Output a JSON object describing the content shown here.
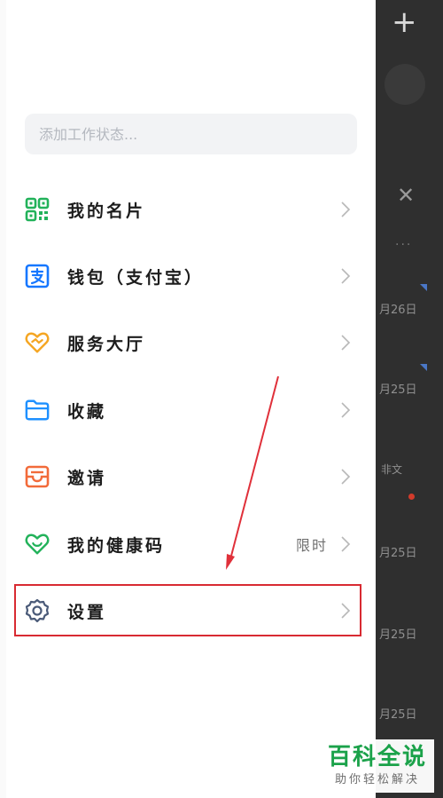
{
  "background": {
    "dates": [
      "月26日",
      "月25日",
      "月25日",
      "月25日",
      "月25日"
    ],
    "note": "非文"
  },
  "status": {
    "placeholder": "添加工作状态..."
  },
  "menu": [
    {
      "label": "我的名片",
      "icon": "qr-code-icon",
      "color": "#22b25a"
    },
    {
      "label": "钱包（支付宝）",
      "icon": "alipay-icon",
      "color": "#1677ff"
    },
    {
      "label": "服务大厅",
      "icon": "heart-service-icon",
      "color": "#f5a623"
    },
    {
      "label": "收藏",
      "icon": "folder-icon",
      "color": "#1e90ff"
    },
    {
      "label": "邀请",
      "icon": "inbox-icon",
      "color": "#f26b3a"
    },
    {
      "label": "我的健康码",
      "icon": "health-heart-icon",
      "color": "#22b25a",
      "badge": "限时"
    },
    {
      "label": "设置",
      "icon": "gear-icon",
      "color": "#4a5a78"
    }
  ],
  "watermark": {
    "title": "百科全说",
    "subtitle": "助你轻松解决"
  },
  "colors": {
    "highlight": "#d82a32",
    "accent_green": "#1ba24a"
  }
}
